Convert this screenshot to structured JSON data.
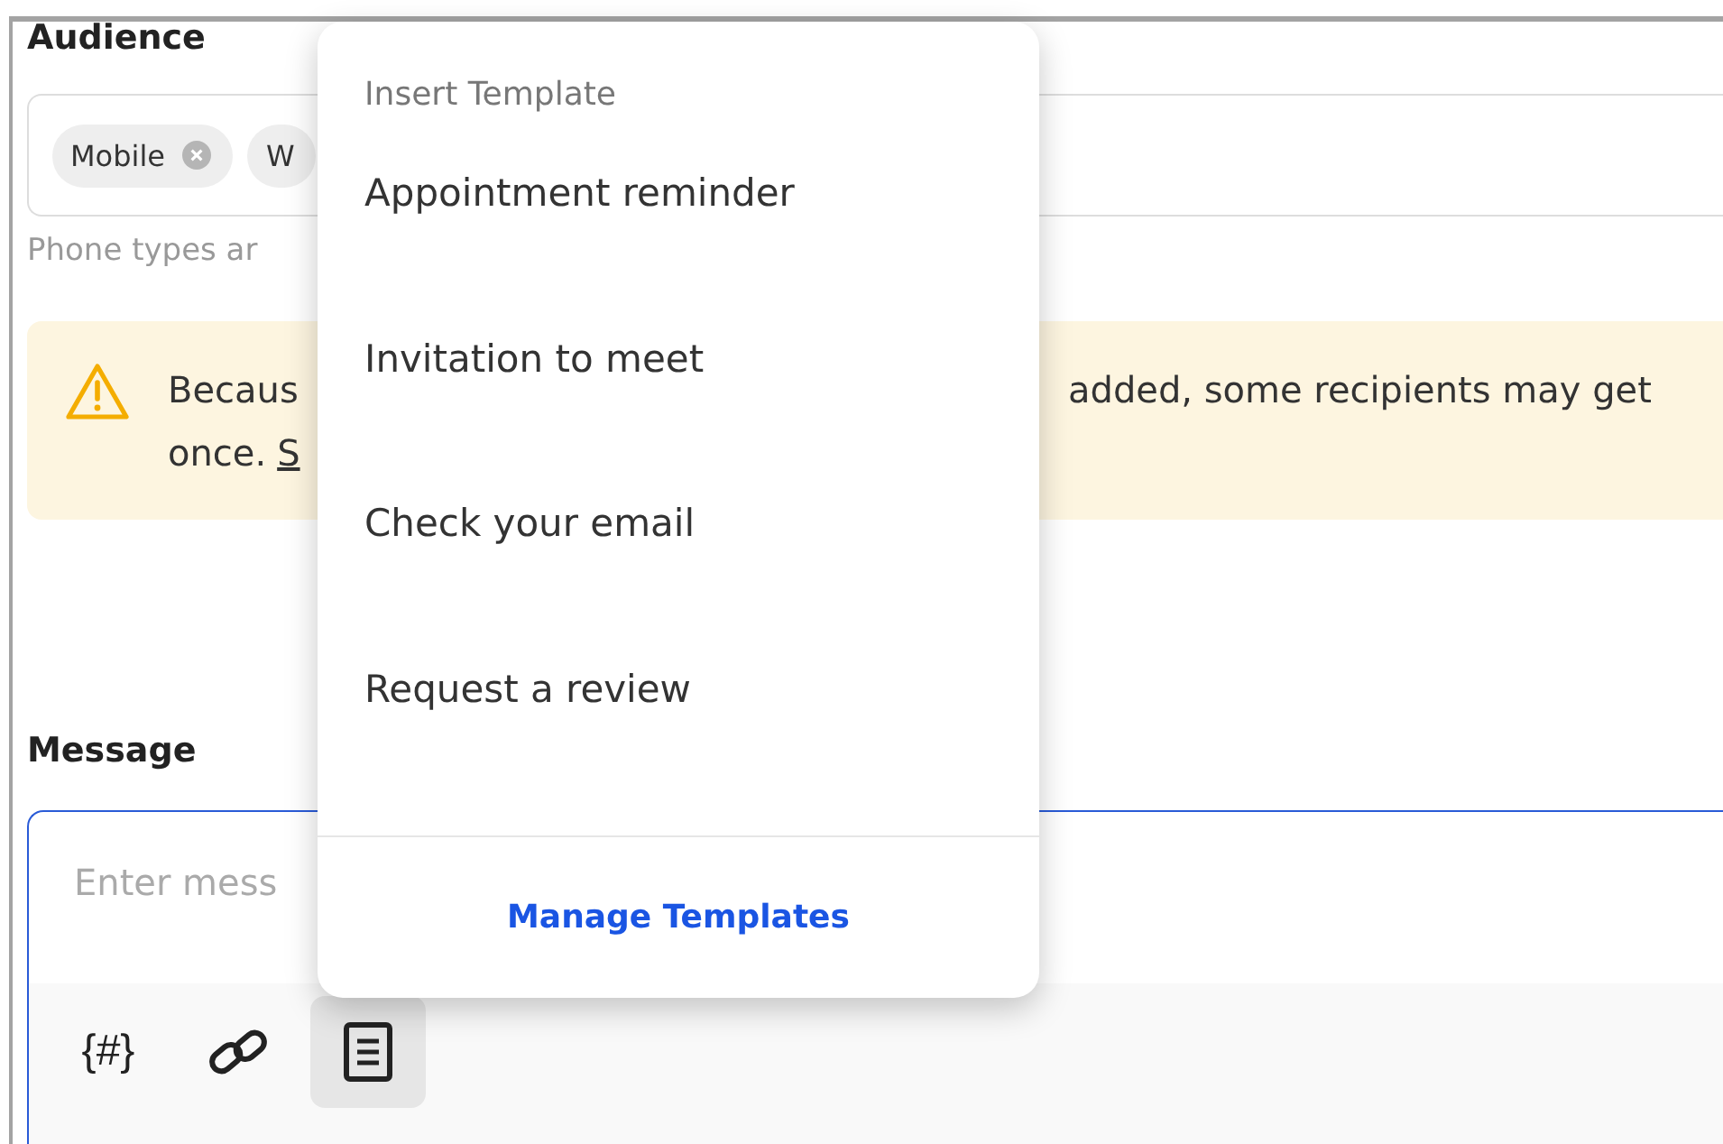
{
  "audience": {
    "label": "Audience",
    "chips": [
      {
        "label": "Mobile",
        "removable": true
      },
      {
        "label": "W",
        "removable": false
      }
    ],
    "hint": "Phone types ar"
  },
  "warning": {
    "line_1_start": "Becaus",
    "line_1_end": "added, some recipients may get",
    "line_2": "once.",
    "link": "S"
  },
  "message": {
    "label": "Message",
    "placeholder": "Enter mess",
    "toolbar": [
      {
        "kind": "variable",
        "symbol": "{#}",
        "active": false
      },
      {
        "kind": "link",
        "active": false
      },
      {
        "kind": "template",
        "active": true
      }
    ]
  },
  "menu": {
    "title": "Insert Template",
    "items": [
      "Appointment reminder",
      "Invitation to meet",
      "Check your email",
      "Request a review"
    ],
    "footer_link": "Manage Templates"
  }
}
